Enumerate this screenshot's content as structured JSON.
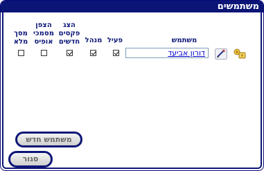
{
  "window": {
    "title": "משתמשים"
  },
  "columns": {
    "user": "משתמש",
    "active": "פעיל",
    "manager": "מנהל",
    "fax_line1": "הצג",
    "fax_line2": "פקסים",
    "fax_line3": "חדשים",
    "office_line1": "הצפן",
    "office_line2": "מסמכי",
    "office_line3": "אופיס",
    "fullscreen_line1": "מסך",
    "fullscreen_line2": "מלא"
  },
  "rows": [
    {
      "name": "דורון אביעד",
      "active": true,
      "manager": true,
      "fax": true,
      "office": false,
      "fullscreen": false
    }
  ],
  "icons": {
    "edit": "pencil-icon",
    "permissions": "key-lock-icon"
  },
  "buttons": {
    "new_user": "משתמש חדש",
    "close": "סגור"
  },
  "colors": {
    "accent": "#0b1576",
    "link": "#0000cc"
  }
}
